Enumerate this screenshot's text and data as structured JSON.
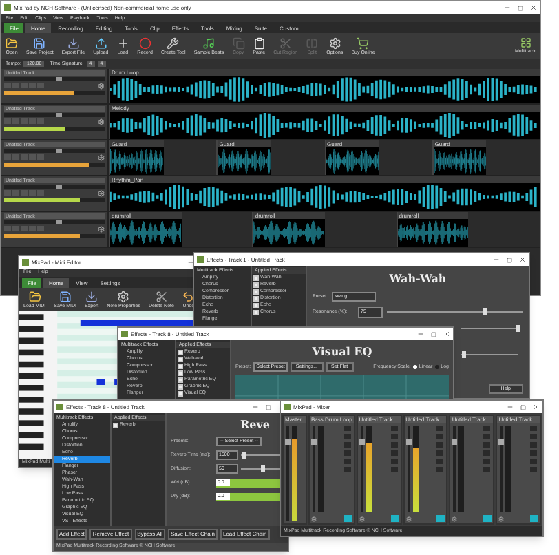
{
  "main_window": {
    "title": "MixPad by NCH Software - (Unlicensed) Non-commercial home use only",
    "menu": [
      "File",
      "Edit",
      "Clips",
      "View",
      "Playback",
      "Tools",
      "Help"
    ],
    "ribbon_tabs": [
      {
        "label": "File",
        "selected": false,
        "kind": "file"
      },
      {
        "label": "Home",
        "selected": true,
        "kind": "tab"
      },
      {
        "label": "Recording",
        "selected": false,
        "kind": "tab"
      },
      {
        "label": "Editing",
        "selected": false,
        "kind": "tab"
      },
      {
        "label": "Tools",
        "selected": false,
        "kind": "tab"
      },
      {
        "label": "Clip",
        "selected": false,
        "kind": "tab"
      },
      {
        "label": "Effects",
        "selected": false,
        "kind": "tab"
      },
      {
        "label": "Tools",
        "selected": false,
        "kind": "tab"
      },
      {
        "label": "Mixing",
        "selected": false,
        "kind": "tab"
      },
      {
        "label": "Suite",
        "selected": false,
        "kind": "tab"
      },
      {
        "label": "Custom",
        "selected": false,
        "kind": "tab"
      }
    ],
    "toolbar": [
      {
        "label": "Open",
        "kind": "open",
        "disabled": false
      },
      {
        "label": "Save Project",
        "kind": "save",
        "disabled": false
      },
      {
        "label": "Export File",
        "kind": "export",
        "disabled": false
      },
      {
        "label": "Upload",
        "kind": "upload",
        "disabled": false
      },
      {
        "label": "Load",
        "kind": "load",
        "disabled": false
      },
      {
        "label": "Record",
        "kind": "record",
        "disabled": false
      },
      {
        "label": "Create Tool",
        "kind": "create",
        "disabled": false
      },
      {
        "label": "Sample Beats",
        "kind": "beats",
        "disabled": false
      },
      {
        "label": "Copy",
        "kind": "copy",
        "disabled": true
      },
      {
        "label": "Paste",
        "kind": "paste",
        "disabled": false
      },
      {
        "label": "Cut Region",
        "kind": "cut",
        "disabled": true
      },
      {
        "label": "Split",
        "kind": "split",
        "disabled": true
      },
      {
        "label": "Options",
        "kind": "options",
        "disabled": false
      },
      {
        "label": "Buy Online",
        "kind": "buy",
        "disabled": false
      }
    ],
    "multitrack_label": "Multitrack",
    "tempo_label": "Tempo:",
    "tempo": "120.00",
    "time_signature_label": "Time Signature:",
    "beats": "4",
    "note": "4",
    "tracks": [
      {
        "name": "Untitled Track",
        "level": 0.7,
        "volume": {
          "level": 0.55
        },
        "segments": [
          {
            "kind": "clip",
            "name": "Drum Loop"
          }
        ]
      },
      {
        "name": "Untitled Track",
        "level": 0.6,
        "volume": {
          "level": 0.55
        },
        "segments": [
          {
            "kind": "clip",
            "name": "Melody"
          }
        ]
      },
      {
        "name": "Untitled Track",
        "level": 0.85,
        "volume": {
          "level": 0.55
        },
        "segments": [
          {
            "kind": "clip",
            "name": "Guard"
          },
          {
            "kind": "gap"
          },
          {
            "kind": "clip",
            "name": "Guard"
          },
          {
            "kind": "gap"
          },
          {
            "kind": "clip",
            "name": "Guard"
          },
          {
            "kind": "gap"
          },
          {
            "kind": "clip",
            "name": "Guard"
          },
          {
            "kind": "gap"
          }
        ]
      },
      {
        "name": "Untitled Track",
        "level": 0.75,
        "volume": {
          "level": 0.55
        },
        "segments": [
          {
            "kind": "clip",
            "name": "Rhythm_Pan"
          }
        ]
      },
      {
        "name": "Untitled Track",
        "level": 0.75,
        "volume": {
          "level": 0.55
        },
        "segments": [
          {
            "kind": "clip",
            "name": "drumroll"
          },
          {
            "kind": "gap"
          },
          {
            "kind": "clip",
            "name": "drumroll"
          },
          {
            "kind": "gap"
          },
          {
            "kind": "clip",
            "name": "drumroll"
          },
          {
            "kind": "gap"
          }
        ]
      }
    ]
  },
  "midi_editor": {
    "title": "MixPad - Midi Editor",
    "menu": [
      "File",
      "Help"
    ],
    "ribbon_tabs": [
      {
        "label": "File",
        "selected": false,
        "kind": "file"
      },
      {
        "label": "Home",
        "selected": true,
        "kind": "tab"
      },
      {
        "label": "View",
        "selected": false,
        "kind": "tab"
      },
      {
        "label": "Settings",
        "selected": false,
        "kind": "tab"
      }
    ],
    "toolbar": [
      {
        "label": "Load MIDI",
        "kind": "open",
        "disabled": false
      },
      {
        "label": "Save MIDI",
        "kind": "save",
        "disabled": false
      },
      {
        "label": "Export",
        "kind": "export",
        "disabled": false
      },
      {
        "label": "Note Properties",
        "kind": "options",
        "disabled": false
      },
      {
        "label": "Delete Note",
        "kind": "cut",
        "disabled": false
      },
      {
        "label": "Undo",
        "kind": "undo",
        "disabled": false
      }
    ],
    "status": "MixPad Multi"
  },
  "effects_wah": {
    "title": "Effects - Track 1 - Untitled Track",
    "list_title": "Multitrack Effects",
    "effects": [
      "Amplify",
      "Chorus",
      "Compressor",
      "Distortion",
      "Echo",
      "Reverb",
      "Flanger"
    ],
    "applied_title": "Applied Effects",
    "applied": [
      {
        "label": "Wah-Wah",
        "checked": true
      },
      {
        "label": "Reverb",
        "checked": true
      },
      {
        "label": "Compressor",
        "checked": true
      },
      {
        "label": "Distortion",
        "checked": true
      },
      {
        "label": "Echo",
        "checked": true
      },
      {
        "label": "Chorus",
        "checked": true
      }
    ],
    "heading": "Wah-Wah",
    "preset_label": "Preset:",
    "preset": "swing",
    "resonance_label": "Resonance (%):",
    "resonance": {
      "value": "75",
      "level": 0.72
    },
    "sliders": [
      {
        "level": 1.0
      },
      {
        "level": 0.05
      }
    ],
    "help": "Help"
  },
  "effects_eq": {
    "title": "Effects - Track 8 - Untitled Track",
    "list_title": "Multitrack Effects",
    "effects": [
      "Amplify",
      "Chorus",
      "Compressor",
      "Distortion",
      "Echo",
      "Reverb",
      "Flanger"
    ],
    "applied_title": "Applied Effects",
    "applied": [
      {
        "label": "Reverb",
        "checked": true
      },
      {
        "label": "Wah-wah",
        "checked": true
      },
      {
        "label": "High Pass",
        "checked": true
      },
      {
        "label": "Low Pass",
        "checked": true
      },
      {
        "label": "Parametric EQ",
        "checked": true
      },
      {
        "label": "Graphic EQ",
        "checked": true
      },
      {
        "label": "Visual EQ",
        "checked": true
      }
    ],
    "heading": "Visual EQ",
    "preset_label": "Preset:",
    "preset": "Select Preset",
    "settings": "Settings...",
    "set_flat": "Set Flat",
    "scale_label": "Frequency Scale:",
    "scales": [
      {
        "label": "Linear",
        "selected": true
      },
      {
        "label": "Log",
        "selected": false
      }
    ]
  },
  "effects_reverb": {
    "title": "Effects - Track 8 - Untitled Track",
    "list_title": "Multitrack Effects",
    "effects": [
      {
        "label": "Amplify",
        "selected": false
      },
      {
        "label": "Chorus",
        "selected": false
      },
      {
        "label": "Compressor",
        "selected": false
      },
      {
        "label": "Distortion",
        "selected": false
      },
      {
        "label": "Echo",
        "selected": false
      },
      {
        "label": "Reverb",
        "selected": true
      },
      {
        "label": "Flanger",
        "selected": false
      },
      {
        "label": "Phaser",
        "selected": false
      },
      {
        "label": "Wah-Wah",
        "selected": false
      },
      {
        "label": "High Pass",
        "selected": false
      },
      {
        "label": "Low Pass",
        "selected": false
      },
      {
        "label": "Parametric EQ",
        "selected": false
      },
      {
        "label": "Graphic EQ",
        "selected": false
      },
      {
        "label": "Visual EQ",
        "selected": false
      },
      {
        "label": "VST Effects",
        "selected": false
      }
    ],
    "applied_title": "Applied Effects",
    "applied": [
      {
        "label": "Reverb",
        "checked": true
      }
    ],
    "heading": "Reve",
    "params": [
      {
        "kind": "select",
        "label": "Presets:",
        "value": "-- Select Preset --"
      },
      {
        "kind": "slider",
        "label": "Reverb Time (ms):",
        "value": "1500",
        "level": 0.05
      },
      {
        "kind": "slider",
        "label": "Diffusion:",
        "value": "50",
        "level": 0.5
      },
      {
        "kind": "bar",
        "label": "Wet (dB):",
        "value": "0.0",
        "level": 1.0
      },
      {
        "kind": "bar",
        "label": "Dry (dB):",
        "value": "0.0",
        "level": 1.0
      }
    ],
    "buttons": [
      "Add Effect",
      "Remove Effect",
      "Bypass All",
      "Save Effect Chain",
      "Load Effect Chain"
    ],
    "status": "MixPad Multitrack Recording Software © NCH Software"
  },
  "mixer": {
    "title": "MixPad - Mixer",
    "channels": [
      {
        "name": "Master",
        "kind": "master",
        "level": 0.85
      },
      {
        "name": "Bass Drum Loop",
        "kind": "track",
        "level": 0
      },
      {
        "name": "Untitled Track",
        "kind": "track",
        "level": 0.8
      },
      {
        "name": "Untitled Track",
        "kind": "track",
        "level": 0.75
      },
      {
        "name": "Untitled Track",
        "kind": "track",
        "level": 0
      },
      {
        "name": "Untitled Track",
        "kind": "track",
        "level": 0
      }
    ],
    "status": "MixPad Multitrack Recording Software © NCH Software"
  }
}
